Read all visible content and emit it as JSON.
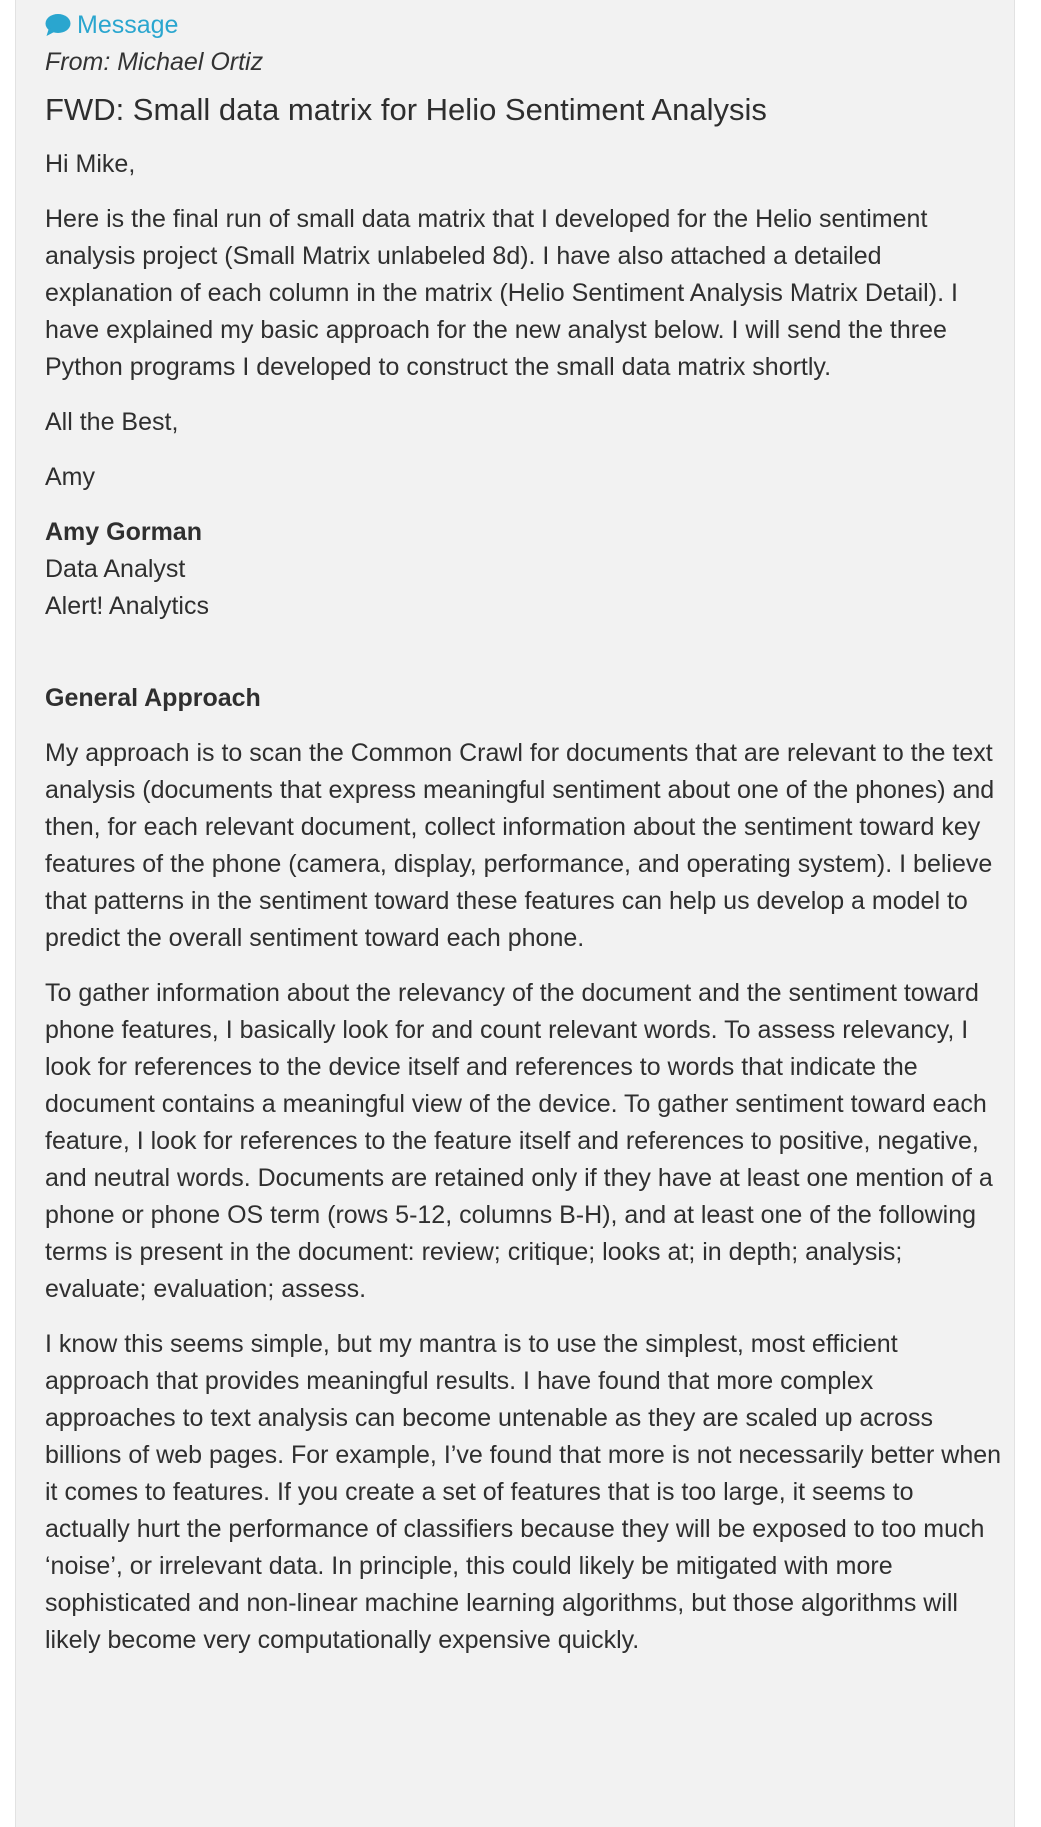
{
  "header": {
    "label": "Message",
    "icon": "speech-bubble-icon",
    "accent_color": "#2aa6cf"
  },
  "email": {
    "from_prefix": "From:",
    "from_name": "Michael Ortiz",
    "subject": "FWD: Small data matrix for Helio Sentiment Analysis",
    "greeting": "Hi Mike,",
    "paragraph1": "Here is the final run of small data matrix that I developed for the Helio sentiment analysis project (Small Matrix unlabeled 8d). I have also attached a detailed explanation of each column in the matrix (Helio Sentiment Analysis Matrix Detail). I have explained my basic approach for the new analyst below. I will send the three Python programs I developed to construct the small data matrix shortly.",
    "closing": "All the Best,",
    "sender_first_name": "Amy",
    "signature": {
      "name": "Amy Gorman",
      "title": "Data Analyst",
      "company": "Alert! Analytics"
    },
    "section_heading": "General Approach",
    "approach_paragraph1": "My approach is to scan the Common Crawl for documents that are relevant to the text analysis (documents that express meaningful sentiment about one of the phones) and then, for each relevant document, collect information about the sentiment toward key features of the phone (camera, display, performance, and operating system). I believe that patterns in the sentiment toward these features can help us develop a model to predict the overall sentiment toward each phone.",
    "approach_paragraph2": "To gather information about the relevancy of the document and the sentiment toward phone features, I basically look for and count relevant words. To assess relevancy, I look for references to the device itself and references to words that indicate the document contains a meaningful view of the device. To gather sentiment toward each feature, I look for references to the feature itself and references to positive, negative, and neutral words. Documents are retained only if they have at least one mention of a phone or phone OS term (rows 5-12, columns B-H), and at least one of the following terms is present in the document: review; critique; looks at; in depth; analysis; evaluate; evaluation; assess.",
    "approach_paragraph3": "I know this seems simple, but my mantra is to use the simplest, most efficient approach that provides meaningful results. I have found that more complex approaches to text analysis can become untenable as they are scaled up across billions of web pages. For example, I’ve found that more is not necessarily better when it comes to features. If you create a set of features that is too large, it seems to actually hurt the performance of classifiers because they will be exposed to too much ‘noise’, or irrelevant data. In principle, this could likely be mitigated with more sophisticated and non-linear machine learning algorithms, but those algorithms will likely become very computationally expensive quickly."
  }
}
